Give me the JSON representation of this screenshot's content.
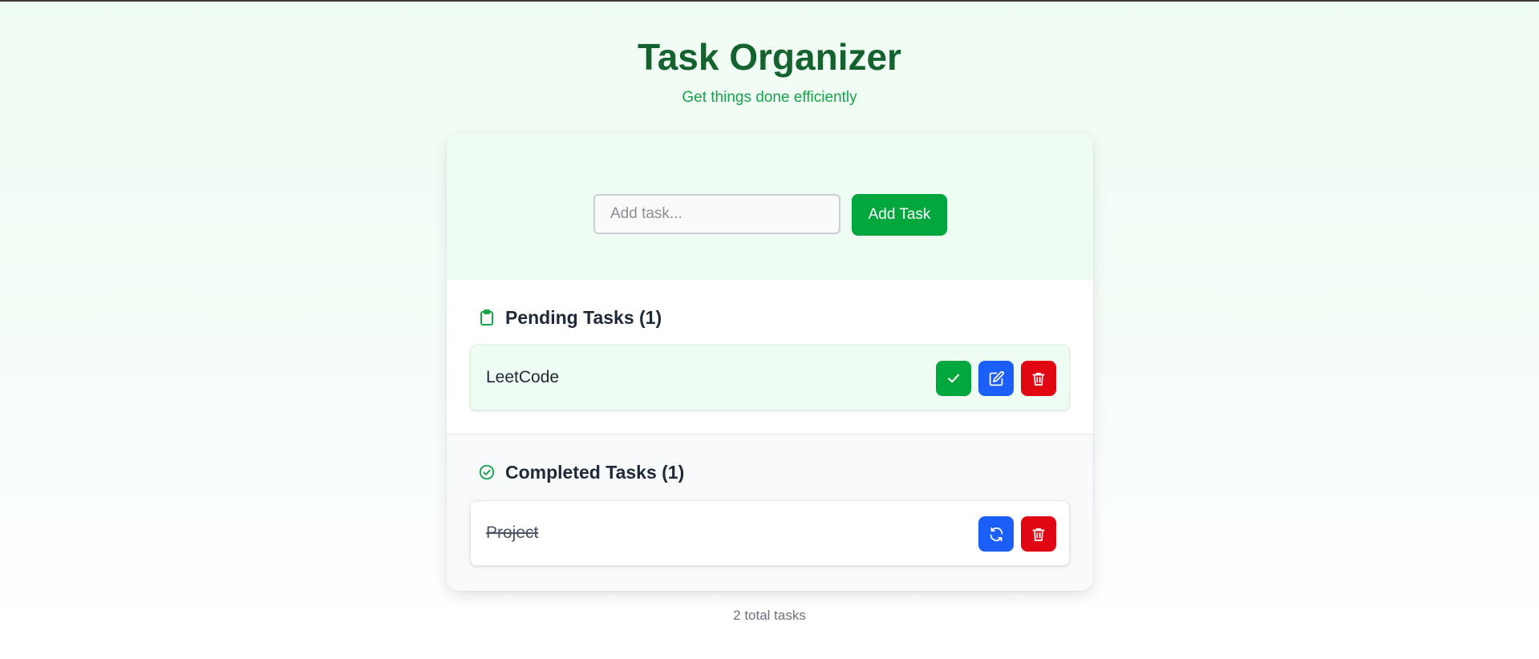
{
  "header": {
    "title": "Task Organizer",
    "subtitle": "Get things done efficiently"
  },
  "add_form": {
    "input_value": "",
    "input_placeholder": "Add task...",
    "button_label": "Add Task"
  },
  "pending": {
    "title": "Pending Tasks (1)",
    "icon": "clipboard-icon",
    "tasks": [
      {
        "text": "LeetCode",
        "actions": [
          "complete-check-icon",
          "edit-pencil-icon",
          "delete-trash-icon"
        ]
      }
    ]
  },
  "completed": {
    "title": "Completed Tasks (1)",
    "icon": "check-circle-icon",
    "tasks": [
      {
        "text": "Project",
        "actions": [
          "restore-refresh-icon",
          "delete-trash-icon"
        ]
      }
    ]
  },
  "footer": {
    "count_text": "2 total tasks"
  },
  "colors": {
    "title": "#14632f",
    "accent_green": "#00a73c",
    "accent_blue": "#1c5ef8",
    "accent_red": "#e10712",
    "panel_tint": "#effcf3"
  }
}
